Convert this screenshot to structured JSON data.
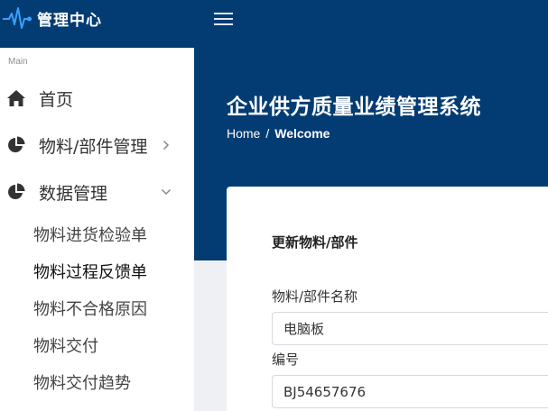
{
  "app": {
    "title": "管理中心",
    "icons": {
      "logo": "heartbeat-icon",
      "menu": "hamburger-icon"
    },
    "colors": {
      "header": "#033c73",
      "sidebar": "#ffffff",
      "page_bg": "#eef0f3"
    }
  },
  "sidebar": {
    "section_label": "Main",
    "items": [
      {
        "label": "首页",
        "icon": "home-icon"
      },
      {
        "label": "物料/部件管理",
        "icon": "pie-chart-icon",
        "chevron": "chevron-right-icon"
      },
      {
        "label": "数据管理",
        "icon": "pie-chart-icon",
        "chevron": "chevron-down-icon",
        "expanded": true
      }
    ],
    "subitems": [
      {
        "label": "物料进货检验单"
      },
      {
        "label": "物料过程反馈单"
      },
      {
        "label": "物料不合格原因"
      },
      {
        "label": "物料交付"
      },
      {
        "label": "物料交付趋势"
      }
    ]
  },
  "page": {
    "title": "企业供方质量业绩管理系统",
    "breadcrumb": {
      "home": "Home",
      "separator": "/",
      "current": "Welcome"
    }
  },
  "form": {
    "title": "更新物料/部件",
    "fields": [
      {
        "label": "物料/部件名称",
        "value": "电脑板"
      },
      {
        "label": "编号",
        "value": "BJ54657676"
      }
    ]
  }
}
